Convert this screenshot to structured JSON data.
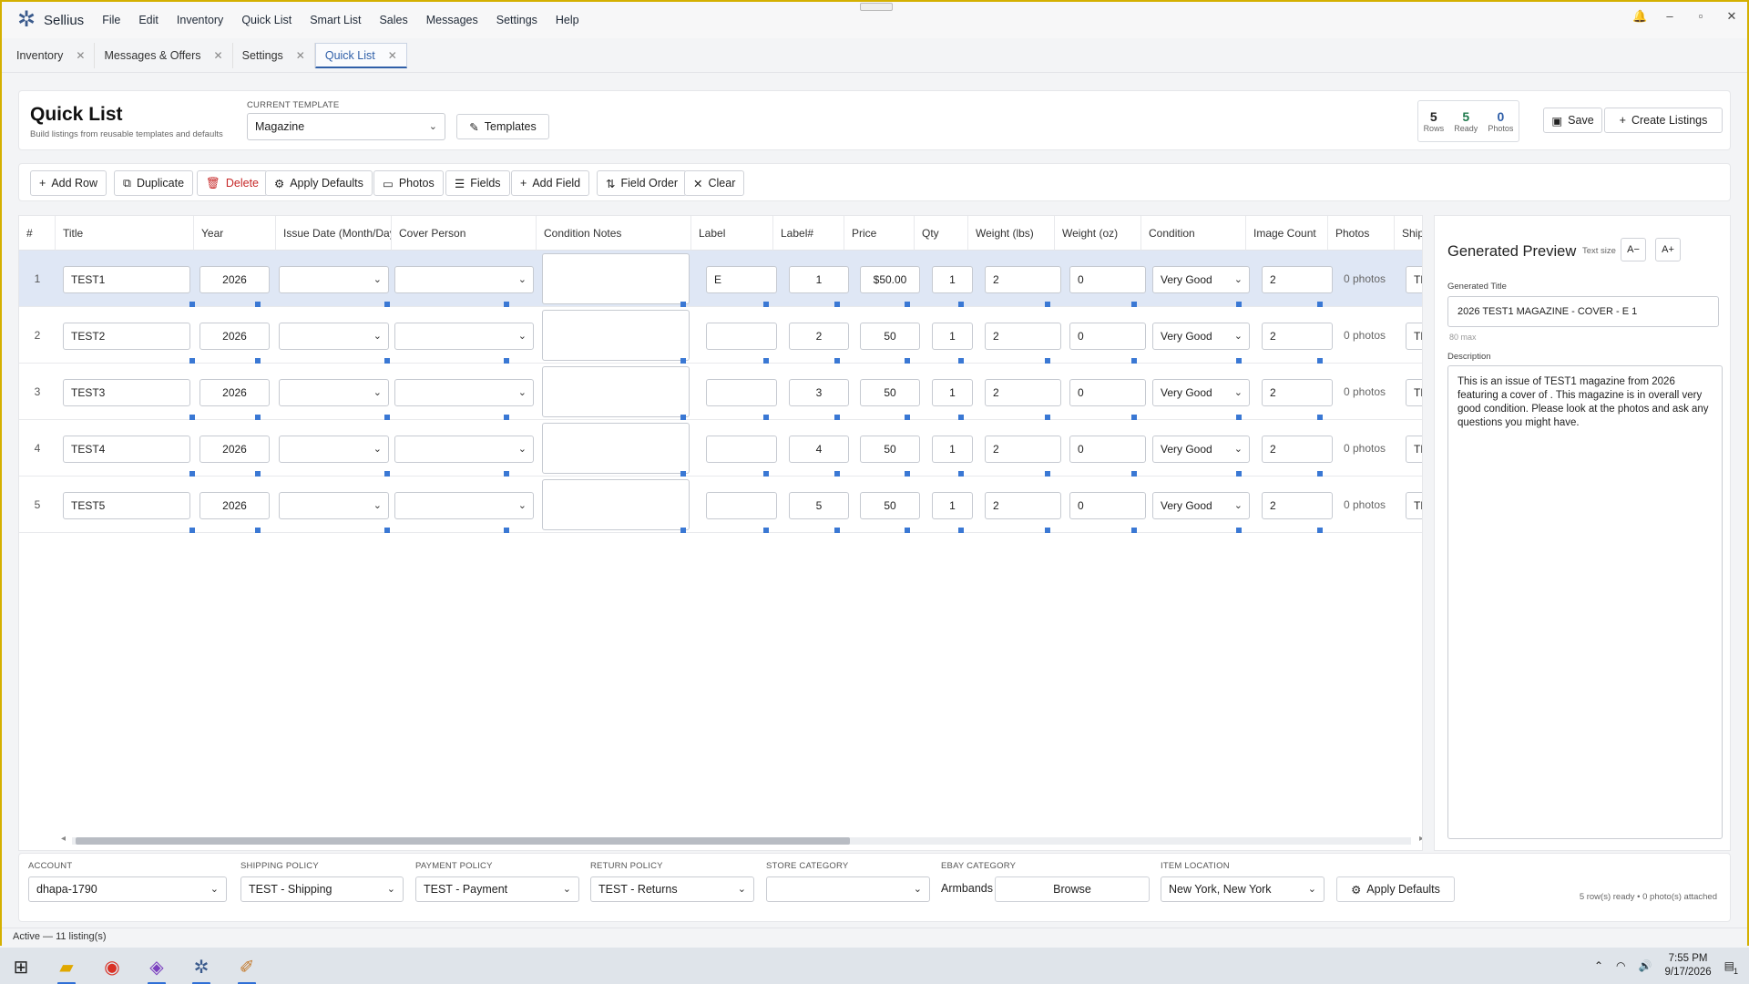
{
  "app": {
    "name": "Sellius",
    "menu": [
      "File",
      "Edit",
      "Inventory",
      "Quick List",
      "Smart List",
      "Sales",
      "Messages",
      "Settings",
      "Help"
    ]
  },
  "tabs": [
    {
      "label": "Inventory",
      "active": false
    },
    {
      "label": "Messages & Offers",
      "active": false
    },
    {
      "label": "Settings",
      "active": false
    },
    {
      "label": "Quick List",
      "active": true
    }
  ],
  "header": {
    "title": "Quick List",
    "subtitle": "Build listings from reusable templates and defaults",
    "template_label": "CURRENT TEMPLATE",
    "template_value": "Magazine",
    "templates_button": "Templates",
    "stats": [
      {
        "value": "5",
        "label": "Rows",
        "color": "#1f2937"
      },
      {
        "value": "5",
        "label": "Ready",
        "color": "#1f7a4d"
      },
      {
        "value": "0",
        "label": "Photos",
        "color": "#2f5fa8"
      }
    ],
    "save_button": "Save",
    "create_button": "Create Listings"
  },
  "toolbar": {
    "buttons": [
      {
        "label": "Add Row",
        "icon": "plus-icon"
      },
      {
        "label": "Duplicate",
        "icon": "copy-icon"
      },
      {
        "label": "Delete",
        "icon": "trash-icon"
      },
      {
        "label": "Apply Defaults",
        "icon": "gear-icon"
      },
      {
        "label": "Photos",
        "icon": "image-icon"
      },
      {
        "label": "Fields",
        "icon": "list-icon"
      },
      {
        "label": "Add Field",
        "icon": "plus-icon"
      },
      {
        "label": "Field Order",
        "icon": "sort-icon"
      },
      {
        "label": "Clear",
        "icon": "close-icon"
      }
    ]
  },
  "grid": {
    "columns": [
      "#",
      "Title",
      "Year",
      "Issue Date (Month/Day)",
      "Cover Person",
      "Condition Notes",
      "Label",
      "Label#",
      "Price",
      "Qty",
      "Weight (lbs)",
      "Weight (oz)",
      "Condition",
      "Image Count",
      "Photos",
      "Shipping"
    ],
    "rows": [
      {
        "num": "1",
        "title": "TEST1",
        "year": "2026",
        "issue_date": "",
        "cover_person": "",
        "notes": "",
        "label": "E",
        "label_num": "1",
        "price": "$50.00",
        "qty": "1",
        "weight_lbs": "2",
        "weight_oz": "0",
        "condition": "Very Good",
        "image_count": "2",
        "photos": "0 photos",
        "shipping": "TEST - Shipping",
        "selected": true
      },
      {
        "num": "2",
        "title": "TEST2",
        "year": "2026",
        "issue_date": "",
        "cover_person": "",
        "notes": "",
        "label": "",
        "label_num": "2",
        "price": "50",
        "qty": "1",
        "weight_lbs": "2",
        "weight_oz": "0",
        "condition": "Very Good",
        "image_count": "2",
        "photos": "0 photos",
        "shipping": "TEST - Shipping",
        "selected": false
      },
      {
        "num": "3",
        "title": "TEST3",
        "year": "2026",
        "issue_date": "",
        "cover_person": "",
        "notes": "",
        "label": "",
        "label_num": "3",
        "price": "50",
        "qty": "1",
        "weight_lbs": "2",
        "weight_oz": "0",
        "condition": "Very Good",
        "image_count": "2",
        "photos": "0 photos",
        "shipping": "TEST - Shipping",
        "selected": false
      },
      {
        "num": "4",
        "title": "TEST4",
        "year": "2026",
        "issue_date": "",
        "cover_person": "",
        "notes": "",
        "label": "",
        "label_num": "4",
        "price": "50",
        "qty": "1",
        "weight_lbs": "2",
        "weight_oz": "0",
        "condition": "Very Good",
        "image_count": "2",
        "photos": "0 photos",
        "shipping": "TEST - Shipping",
        "selected": false
      },
      {
        "num": "5",
        "title": "TEST5",
        "year": "2026",
        "issue_date": "",
        "cover_person": "",
        "notes": "",
        "label": "",
        "label_num": "5",
        "price": "50",
        "qty": "1",
        "weight_lbs": "2",
        "weight_oz": "0",
        "condition": "Very Good",
        "image_count": "2",
        "photos": "0 photos",
        "shipping": "TEST - Shipping",
        "selected": false
      }
    ]
  },
  "preview": {
    "heading": "Generated Preview",
    "text_size_label": "Text size",
    "decrease_label": "A−",
    "increase_label": "A+",
    "title_label": "Generated Title",
    "title_value": "2026  TEST1 MAGAZINE -  COVER - E 1",
    "title_max": "80 max",
    "description_label": "Description",
    "description": "This is an issue of TEST1 magazine from  2026 featuring a cover of . This magazine is in overall very good condition.  Please look at the photos and ask any questions you might have."
  },
  "footer": {
    "account_label": "ACCOUNT",
    "account_value": "dhapa-1790",
    "shipping_label": "SHIPPING POLICY",
    "shipping_value": "TEST - Shipping",
    "payment_label": "PAYMENT POLICY",
    "payment_value": "TEST - Payment",
    "return_label": "RETURN POLICY",
    "return_value": "TEST - Returns",
    "store_label": "STORE CATEGORY",
    "store_value": "",
    "ebay_label": "eBAY CATEGORY",
    "ebay_value": "Armbands",
    "browse_button": "Browse",
    "location_label": "ITEM LOCATION",
    "location_value": "New York, New York",
    "apply_defaults_button": "Apply Defaults",
    "note": "5 row(s) ready • 0 photo(s) attached"
  },
  "status": {
    "text": "Active  —  11 listing(s)"
  },
  "taskbar": {
    "time": "7:55 PM",
    "date": "9/17/2026",
    "notifications": "1"
  },
  "colors": {
    "accent": "#2f5fa8",
    "danger": "#c62828",
    "selected_row": "#dfe7f5",
    "handle": "#3a78d4"
  }
}
